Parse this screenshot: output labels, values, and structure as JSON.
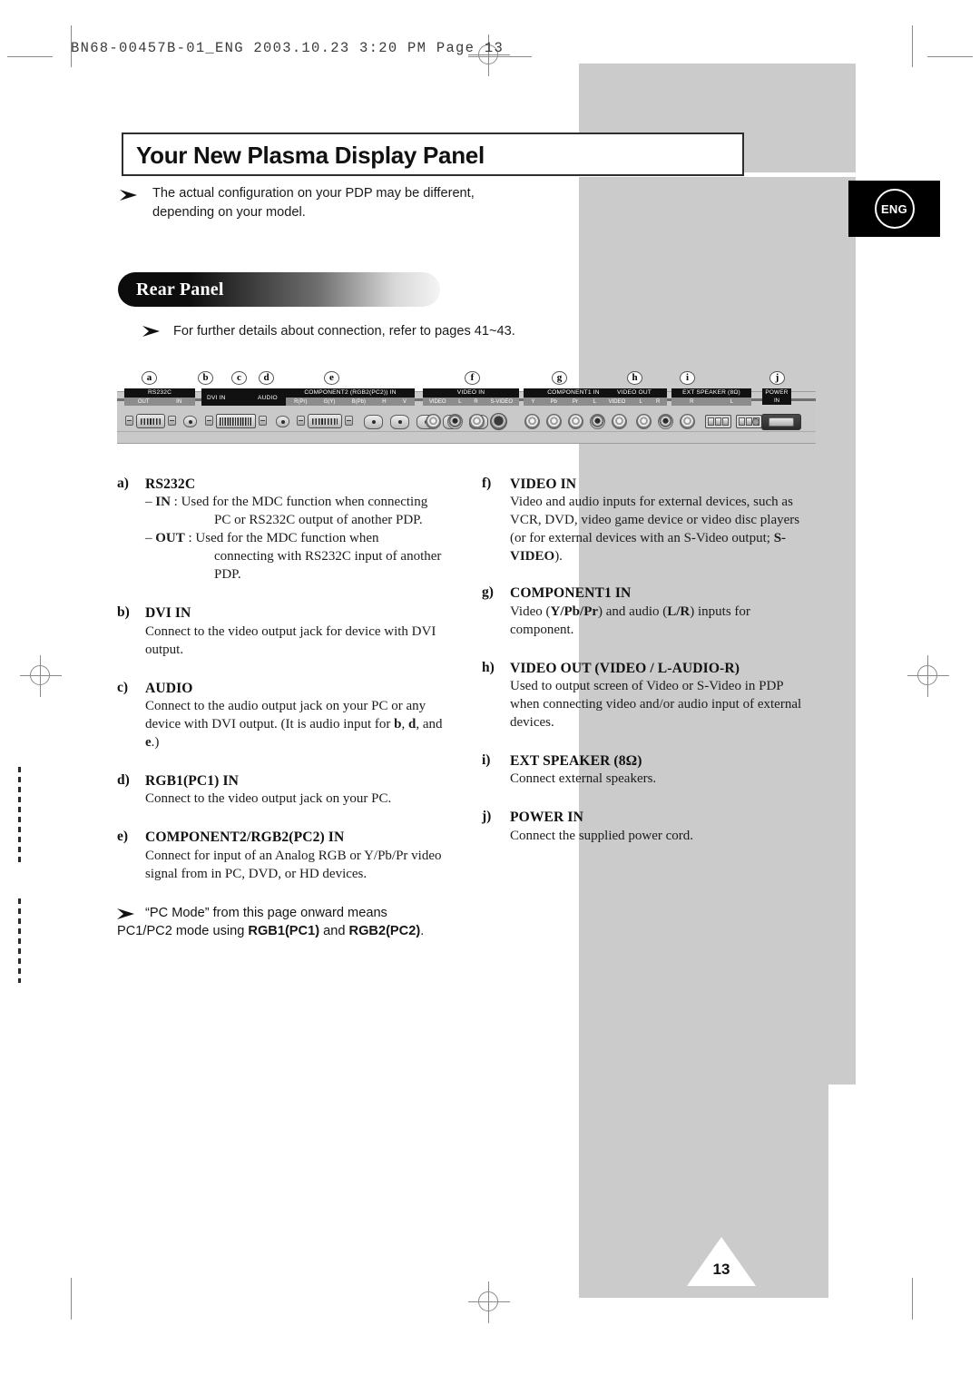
{
  "print_marks": {
    "header": "BN68-00457B-01_ENG   2003.10.23  3:20 PM   Page 13"
  },
  "header": {
    "title": "Your New Plasma Display Panel",
    "note": "The actual configuration on your PDP may be different, depending on your model.",
    "language_badge": "ENG"
  },
  "section": {
    "heading": "Rear Panel",
    "note": "For further details about connection, refer to pages 41~43."
  },
  "panel_diagram": {
    "markers": [
      "a",
      "b",
      "c",
      "d",
      "e",
      "f",
      "g",
      "h",
      "i",
      "j"
    ],
    "labels": [
      {
        "id": "a",
        "main": "RS232C",
        "sub": [
          "OUT",
          "IN"
        ]
      },
      {
        "id": "b",
        "main": "DVI IN",
        "sub": []
      },
      {
        "id": "c",
        "main": "AUDIO",
        "sub": []
      },
      {
        "id": "d",
        "main": "RGB1(PC1) IN",
        "sub": []
      },
      {
        "id": "e",
        "main": "COMPONENT2 (RGB2(PC2)) IN",
        "sub": [
          "R(Pr)",
          "G(Y)",
          "B(Pb)",
          "H",
          "V"
        ]
      },
      {
        "id": "f",
        "main": "VIDEO IN",
        "sub": [
          "VIDEO",
          "L",
          "R",
          "S-VIDEO"
        ]
      },
      {
        "id": "g",
        "main": "COMPONENT1 IN",
        "sub": [
          "Y",
          "Pb",
          "Pr",
          "L",
          "R"
        ]
      },
      {
        "id": "h",
        "main": "VIDEO OUT",
        "sub": [
          "VIDEO",
          "L",
          "R"
        ]
      },
      {
        "id": "i",
        "main": "EXT SPEAKER (8Ω)",
        "sub": [
          "R",
          "L"
        ]
      },
      {
        "id": "j",
        "main": "POWER",
        "sub": [
          "IN"
        ]
      }
    ]
  },
  "left_column": [
    {
      "index": "a)",
      "heading": "RS232C",
      "sub_rows": [
        {
          "dash": "–",
          "term": "IN",
          "text": " : Used for the MDC function when connecting",
          "cont": "PC or RS232C output of another PDP."
        },
        {
          "dash": "–",
          "term": "OUT",
          "text": " : Used for the MDC function when",
          "cont": "connecting with RS232C input of another PDP."
        }
      ]
    },
    {
      "index": "b)",
      "heading": "DVI IN",
      "body": "Connect to the video output jack for device with DVI output."
    },
    {
      "index": "c)",
      "heading": "AUDIO",
      "body_html": "Connect to the audio output jack on your PC or any device with DVI output. (It is audio input for <b>b</b>, <b>d</b>, and <b>e</b>.)"
    },
    {
      "index": "d)",
      "heading": "RGB1(PC1) IN",
      "body": "Connect to the video output jack on your PC."
    },
    {
      "index": "e)",
      "heading": "COMPONENT2/RGB2(PC2) IN",
      "body": "Connect for input of an Analog RGB or Y/Pb/Pr video signal from in PC, DVD, or HD devices."
    }
  ],
  "left_column_note_html": "“PC Mode” from this page onward means PC1/PC2 mode using <b>RGB1(PC1)</b> and <b>RGB2(PC2)</b>.",
  "right_column": [
    {
      "index": "f)",
      "heading": "VIDEO IN",
      "body_html": "Video and audio inputs for external devices, such as VCR, DVD, video game device or video disc players (or for external devices with an S-Video output; <b>S-VIDEO</b>)."
    },
    {
      "index": "g)",
      "heading": "COMPONENT1 IN",
      "body_html": "Video (<b>Y/Pb/Pr</b>) and audio (<b>L/R</b>) inputs for component."
    },
    {
      "index": "h)",
      "heading": "VIDEO OUT (VIDEO / L-AUDIO-R)",
      "body": "Used to output screen of Video or S-Video in PDP when connecting video and/or audio input of external devices."
    },
    {
      "index": "i)",
      "heading": "EXT SPEAKER (8Ω)",
      "body": "Connect external speakers."
    },
    {
      "index": "j)",
      "heading": "POWER IN",
      "body": "Connect the supplied power cord."
    }
  ],
  "footer": {
    "page_number": "13"
  },
  "colors": {
    "grey_backdrop": "#cbcbcb",
    "ink": "#111111",
    "panel_body": "#c9c9c9",
    "label_black": "#111111"
  }
}
